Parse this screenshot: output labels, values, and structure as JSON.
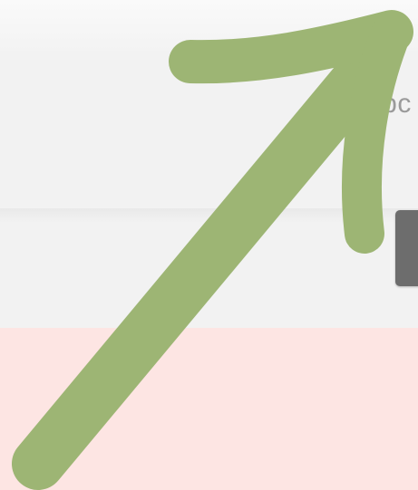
{
  "header": {
    "partial_label": "upc"
  },
  "annotation": {
    "icon": "arrow-up-right-icon",
    "color": "#9db574"
  },
  "colors": {
    "background": "#f2f2f2",
    "button": "#6d6d6d",
    "alert_background": "#fde5e3"
  }
}
